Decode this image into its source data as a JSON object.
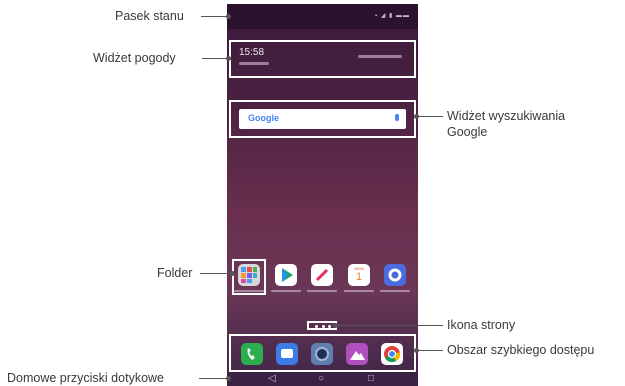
{
  "labels": {
    "status_bar": "Pasek stanu",
    "weather_widget": "Widżet pogody",
    "google_widget_line1": "Widżet wyszukiwania",
    "google_widget_line2": "Google",
    "folder": "Folder",
    "page_icon": "Ikona strony",
    "quick_access": "Obszar szybkiego dostępu",
    "home_touch_buttons": "Domowe przyciski dotykowe"
  },
  "phone": {
    "weather_time": "15:58",
    "search_logo": "Google",
    "calendar_month": "MON",
    "calendar_day": "1",
    "nav_back": "◁",
    "nav_home": "○",
    "nav_recent": "□"
  },
  "colors": {
    "wallpaper_top": "#3b1a3d",
    "wallpaper_mid": "#6a2f4e",
    "highlight": "#ffffff"
  },
  "icons": [
    "folder-icon",
    "play-store-icon",
    "pencil-icon",
    "calendar-icon",
    "settings-icon",
    "phone-icon",
    "messages-icon",
    "camera-icon",
    "gallery-icon",
    "chrome-icon"
  ]
}
